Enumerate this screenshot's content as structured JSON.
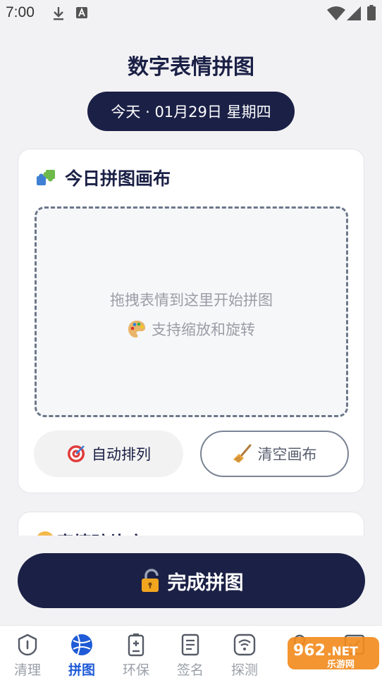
{
  "status_bar": {
    "time": "7:00"
  },
  "header": {
    "title": "数字表情拼图",
    "date": "今天 · 01月29日 星期四"
  },
  "canvas_card": {
    "title": "今日拼图画布",
    "hint_line1": "拖拽表情到这里开始拼图",
    "hint_line2": "支持缩放和旋转",
    "auto_arrange_label": "自动排列",
    "clear_canvas_label": "清空画布"
  },
  "second_card": {
    "title": "表情碎片库"
  },
  "complete_button": {
    "label": "完成拼图"
  },
  "bottom_nav": {
    "items": [
      {
        "label": "清理",
        "icon": "shield-icon",
        "active": false
      },
      {
        "label": "拼图",
        "icon": "ball-icon",
        "active": true
      },
      {
        "label": "环保",
        "icon": "battery-icon",
        "active": false
      },
      {
        "label": "签名",
        "icon": "document-icon",
        "active": false
      },
      {
        "label": "探测",
        "icon": "wifi-icon",
        "active": false
      },
      {
        "label": "",
        "icon": "person-icon",
        "active": false
      },
      {
        "label": "",
        "icon": "checkbox-icon",
        "active": false
      }
    ]
  },
  "watermark": {
    "text_top": "962",
    "text_suffix": ".NET",
    "text_bottom": "乐游网"
  },
  "colors": {
    "primary": "#1b2046",
    "accent": "#1f5bd6",
    "background": "#f2f2f4"
  }
}
